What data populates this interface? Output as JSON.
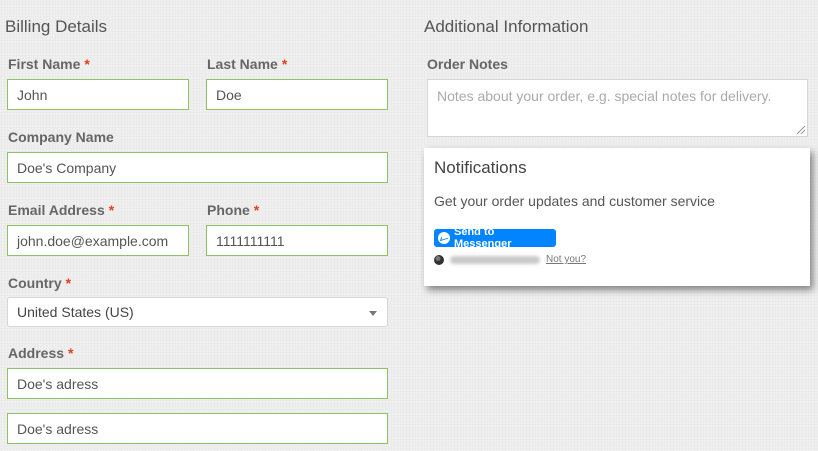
{
  "billing": {
    "title": "Billing Details",
    "first_name": {
      "label": "First Name",
      "value": "John"
    },
    "last_name": {
      "label": "Last Name",
      "value": "Doe"
    },
    "company": {
      "label": "Company Name",
      "value": "Doe's Company"
    },
    "email": {
      "label": "Email Address",
      "value": "john.doe@example.com"
    },
    "phone": {
      "label": "Phone",
      "value": "1111111111"
    },
    "country": {
      "label": "Country",
      "value": "United States (US)"
    },
    "address": {
      "label": "Address",
      "line1": "Doe's adress",
      "line2": "Doe's adress"
    },
    "required_mark": "*"
  },
  "additional": {
    "title": "Additional Information",
    "order_notes": {
      "label": "Order Notes",
      "placeholder": "Notes about your order, e.g. special notes for delivery."
    }
  },
  "notifications": {
    "title": "Notifications",
    "text": "Get your order updates and customer service",
    "button_label": "Send to Messenger",
    "not_you": "Not you?"
  },
  "colors": {
    "required": "#e2401c",
    "valid_border": "#8fc35f",
    "messenger_blue": "#0084ff"
  }
}
